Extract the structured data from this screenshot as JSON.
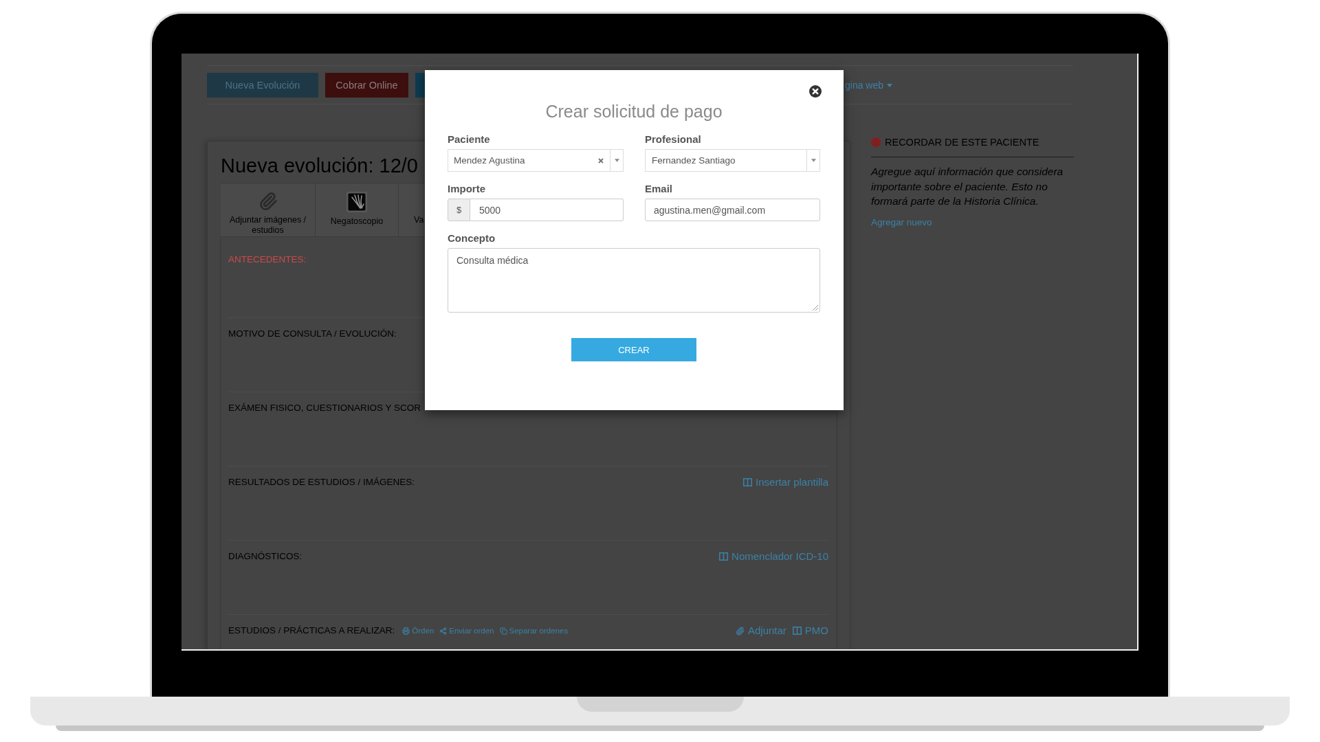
{
  "top_bar": {
    "buttons": [
      {
        "label": "Nueva Evolución",
        "kind": "primary"
      },
      {
        "label": "Cobrar Online",
        "kind": "danger"
      },
      {
        "kind": "info"
      }
    ],
    "menu": {
      "label": "gina web"
    }
  },
  "evolution": {
    "title": "Nueva evolución: 12/0",
    "tools": [
      {
        "label": "Adjuntar imágenes / estudios",
        "kind": "attach"
      },
      {
        "label": "Negatoscopio",
        "kind": "xray"
      },
      {
        "label": "Va"
      }
    ],
    "sections": [
      {
        "title": "ANTECEDENTES:",
        "highlighted": true
      },
      {
        "title": "MOTIVO DE CONSULTA / EVOLUCIÓN:",
        "highlighted": false
      },
      {
        "title": "EXÁMEN FISICO, CUESTIONARIOS Y SCOR",
        "highlighted": false
      },
      {
        "title": "RESULTADOS DE ESTUDIOS / IMÁGENES:",
        "highlighted": false,
        "links": [
          {
            "label": "Insertar plantilla",
            "kind": "template"
          }
        ]
      },
      {
        "title": "DIAGNÓSTICOS:",
        "highlighted": false,
        "links": [
          {
            "label": "Nomenclador ICD-10",
            "kind": "template"
          }
        ]
      },
      {
        "title": "ESTUDIOS / PRÁCTICAS A REALIZAR:",
        "highlighted": false,
        "inline_links": [
          {
            "label": "Órden",
            "kind": "print"
          },
          {
            "label": "Enviar orden",
            "kind": "share"
          },
          {
            "label": "Separar ordenes",
            "kind": "copy"
          }
        ],
        "links": [
          {
            "label": "Adjuntar",
            "kind": "attach"
          },
          {
            "label": "PMO",
            "kind": "template"
          }
        ]
      }
    ]
  },
  "sidebar": {
    "title": "RECORDAR DE ESTE PACIENTE",
    "note": "Agregue aquí información que considera importante sobre el paciente. Esto no formará parte de la Historia Clínica.",
    "action": "Agregar nuevo"
  },
  "dialog": {
    "title": "Crear solicitud de pago",
    "fields": [
      {
        "label": "Paciente",
        "kind": "select",
        "value": "Mendez Agustina",
        "clearable": true
      },
      {
        "label": "Profesional",
        "kind": "select",
        "value": "Fernandez Santiago",
        "clearable": false
      },
      {
        "label": "Importe",
        "kind": "currency",
        "prefix": "$",
        "value": "5000"
      },
      {
        "label": "Email",
        "kind": "text",
        "value": "agustina.men@gmail.com"
      },
      {
        "label": "Concepto",
        "kind": "textarea",
        "value": "Consulta médica"
      }
    ],
    "submit": "CREAR"
  }
}
